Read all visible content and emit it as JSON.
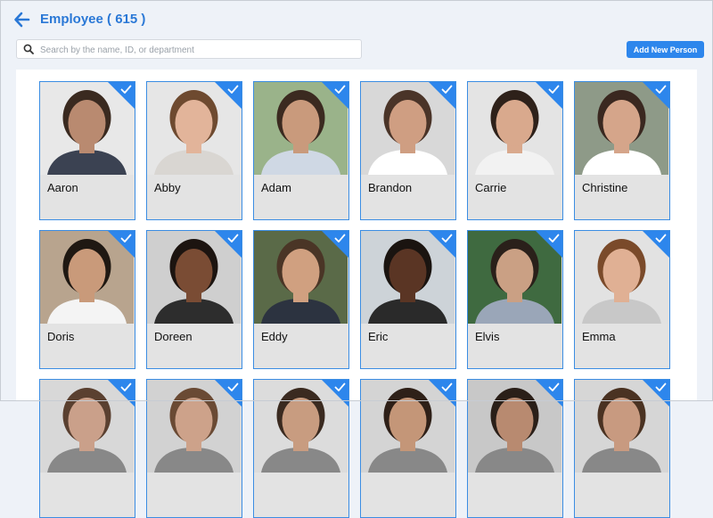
{
  "header": {
    "title": "Employee ( 615 )"
  },
  "search": {
    "placeholder": "Search by the name, ID, or department"
  },
  "actions": {
    "add_label": "Add New Person"
  },
  "colors": {
    "accent": "#2d86ec",
    "title": "#2a78d6"
  },
  "icons": {
    "back": "arrow-left-icon",
    "search": "search-icon",
    "selected": "checkmark-icon"
  },
  "employees": [
    {
      "name": "Aaron",
      "selected": true,
      "bg": "#e8e8e8",
      "skin": "#b98a70",
      "hair": "#3a2a20",
      "shirt": "#3b4252"
    },
    {
      "name": "Abby",
      "selected": true,
      "bg": "#e6e6e6",
      "skin": "#e2b49a",
      "hair": "#6e4a30",
      "shirt": "#d9d6d2"
    },
    {
      "name": "Adam",
      "selected": true,
      "bg": "#9ab38a",
      "skin": "#c99a7c",
      "hair": "#3b2a20",
      "shirt": "#cfd8e4"
    },
    {
      "name": "Brandon",
      "selected": true,
      "bg": "#d8d8d8",
      "skin": "#cf9e82",
      "hair": "#4a3428",
      "shirt": "#ffffff"
    },
    {
      "name": "Carrie",
      "selected": true,
      "bg": "#e4e4e4",
      "skin": "#d9a98d",
      "hair": "#2e211a",
      "shirt": "#f2f2f2"
    },
    {
      "name": "Christine",
      "selected": true,
      "bg": "#8e9a88",
      "skin": "#d5a58a",
      "hair": "#3a2820",
      "shirt": "#ffffff"
    },
    {
      "name": "Doris",
      "selected": true,
      "bg": "#b8a48e",
      "skin": "#c99a7a",
      "hair": "#1f1812",
      "shirt": "#f4f4f4"
    },
    {
      "name": "Doreen",
      "selected": true,
      "bg": "#cfcfcf",
      "skin": "#7a4c34",
      "hair": "#1c1410",
      "shirt": "#2d2d2d"
    },
    {
      "name": "Eddy",
      "selected": true,
      "bg": "#5a6a48",
      "skin": "#d0a080",
      "hair": "#4a3526",
      "shirt": "#2c3340"
    },
    {
      "name": "Eric",
      "selected": true,
      "bg": "#cdd3d8",
      "skin": "#5a3524",
      "hair": "#1a1410",
      "shirt": "#2a2a2a"
    },
    {
      "name": "Elvis",
      "selected": true,
      "bg": "#3f6a40",
      "skin": "#caa084",
      "hair": "#2a201a",
      "shirt": "#9aa6b8"
    },
    {
      "name": "Emma",
      "selected": true,
      "bg": "#e2e2e2",
      "skin": "#e0b094",
      "hair": "#7a4a2a",
      "shirt": "#c8c8c8"
    },
    {
      "name": "",
      "selected": true,
      "bg": "#d8d8d8",
      "skin": "#caa08a",
      "hair": "#5a4030",
      "shirt": "#888888"
    },
    {
      "name": "",
      "selected": true,
      "bg": "#d2d2d2",
      "skin": "#cda28a",
      "hair": "#6a4a34",
      "shirt": "#888888"
    },
    {
      "name": "",
      "selected": true,
      "bg": "#dcdcdc",
      "skin": "#c89c80",
      "hair": "#3a2a20",
      "shirt": "#888888"
    },
    {
      "name": "",
      "selected": true,
      "bg": "#d4d4d4",
      "skin": "#c49678",
      "hair": "#2e2018",
      "shirt": "#888888"
    },
    {
      "name": "",
      "selected": true,
      "bg": "#c8c8c8",
      "skin": "#b88a70",
      "hair": "#2a1f18",
      "shirt": "#888888"
    },
    {
      "name": "",
      "selected": true,
      "bg": "#d6d6d6",
      "skin": "#c89a80",
      "hair": "#4a3222",
      "shirt": "#888888"
    }
  ]
}
